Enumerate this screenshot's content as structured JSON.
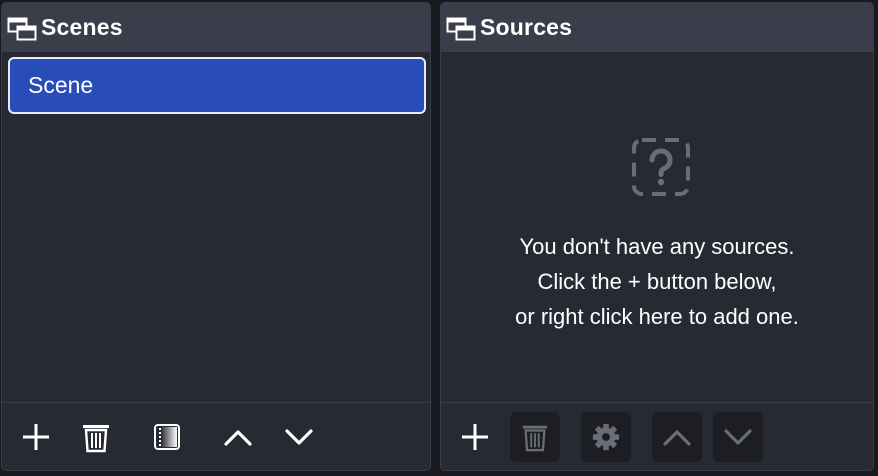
{
  "scenes_dock": {
    "title": "Scenes",
    "title_icon": "dock-window-icon",
    "items": [
      {
        "label": "Scene",
        "selected": true
      }
    ],
    "toolbar": [
      {
        "icon": "plus-icon",
        "action": "add-scene"
      },
      {
        "icon": "trash-icon",
        "action": "remove-scene"
      },
      {
        "icon": "filter-icon",
        "action": "scene-filters"
      },
      {
        "icon": "chevron-up-icon",
        "action": "move-scene-up"
      },
      {
        "icon": "chevron-down-icon",
        "action": "move-scene-down"
      }
    ]
  },
  "sources_dock": {
    "title": "Sources",
    "title_icon": "dock-window-icon",
    "empty_state": {
      "icon": "question-icon",
      "lines": [
        "You don't have any sources.",
        "Click the + button below,",
        "or right click here to add one."
      ]
    },
    "toolbar": [
      {
        "icon": "plus-icon",
        "action": "add-source",
        "enabled": true
      },
      {
        "icon": "trash-icon",
        "action": "remove-source",
        "enabled": false
      },
      {
        "icon": "gear-icon",
        "action": "source-properties",
        "enabled": false
      },
      {
        "icon": "chevron-up-icon",
        "action": "move-source-up",
        "enabled": false
      },
      {
        "icon": "chevron-down-icon",
        "action": "move-source-down",
        "enabled": false
      }
    ]
  },
  "colors": {
    "panel_bg": "#272a33",
    "header_bg": "#3b3e4a",
    "selection": "#284cb8",
    "disabled_button_bg": "#1c1e24",
    "icon_enabled": "#ffffff",
    "icon_disabled": "#6a6d75"
  }
}
